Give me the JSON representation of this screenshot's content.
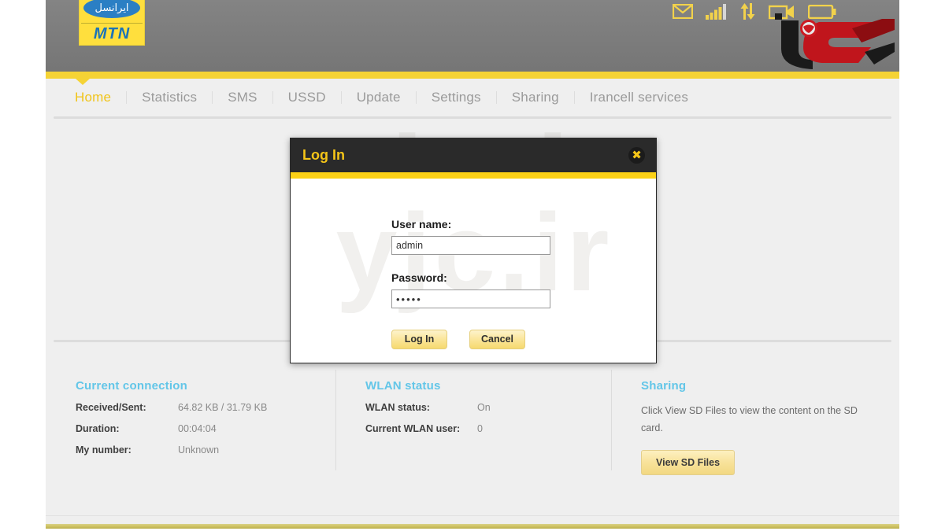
{
  "header": {
    "logo": {
      "brand_script": "ایرانسل",
      "brand_latin": "MTN"
    },
    "status_icons": [
      {
        "name": "message-icon",
        "label": "Messages"
      },
      {
        "name": "signal-strength-icon",
        "label": "Signal"
      },
      {
        "name": "data-transfer-icon",
        "label": "Data transfer"
      },
      {
        "name": "sim-card-icon",
        "label": "SIM card"
      },
      {
        "name": "battery-icon",
        "label": "Battery"
      }
    ],
    "accent_yellow": "#f5d335",
    "header_gray": "#7c7c7c"
  },
  "nav": {
    "items": [
      {
        "label": "Home",
        "active": true
      },
      {
        "label": "Statistics",
        "active": false
      },
      {
        "label": "SMS",
        "active": false
      },
      {
        "label": "USSD",
        "active": false
      },
      {
        "label": "Update",
        "active": false
      },
      {
        "label": "Settings",
        "active": false
      },
      {
        "label": "Sharing",
        "active": false
      },
      {
        "label": "Irancell services",
        "active": false
      }
    ],
    "active_color": "#f0c419",
    "inactive_color": "#9a9a9a"
  },
  "watermark": {
    "page": "yjc.ir",
    "modal": "yjc.ir"
  },
  "dialog": {
    "title": "Log In",
    "close_glyph": "✖",
    "username": {
      "label": "User name:",
      "value": "admin"
    },
    "password": {
      "label": "Password:",
      "value": "•••••"
    },
    "buttons": {
      "login": "Log In",
      "cancel": "Cancel"
    },
    "title_color": "#f5c518",
    "accent_color": "#fcd116"
  },
  "panels": {
    "title_color": "#63c6e8",
    "current_connection": {
      "title": "Current connection",
      "rows": [
        {
          "key": "Received/Sent:",
          "value": "64.82 KB / 31.79 KB"
        },
        {
          "key": "Duration:",
          "value": "00:04:04"
        },
        {
          "key": "My number:",
          "value": "Unknown"
        }
      ]
    },
    "wlan_status": {
      "title": "WLAN status",
      "rows": [
        {
          "key": "WLAN status:",
          "value": "On"
        },
        {
          "key": "Current WLAN user:",
          "value": "0"
        }
      ]
    },
    "sharing": {
      "title": "Sharing",
      "description": "Click View SD Files to view the content on the SD card.",
      "button": "View SD Files"
    }
  }
}
